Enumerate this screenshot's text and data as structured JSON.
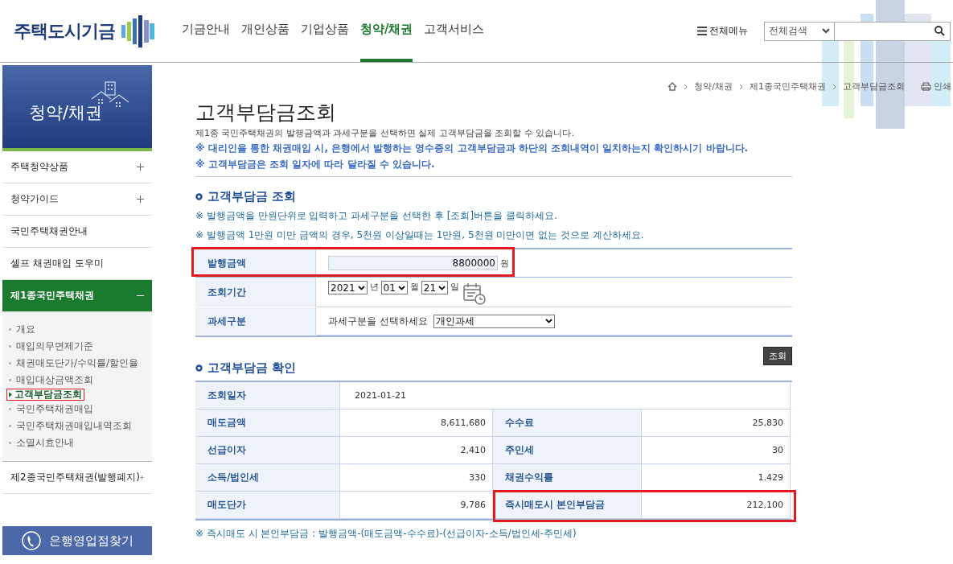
{
  "header": {
    "logo": "주택도시기금",
    "nav": [
      {
        "label": "기금안내",
        "selected": false
      },
      {
        "label": "개인상품",
        "selected": false
      },
      {
        "label": "기업상품",
        "selected": false
      },
      {
        "label": "청약/채권",
        "selected": true
      },
      {
        "label": "고객서비스",
        "selected": false
      }
    ],
    "all_menu": "전체메뉴",
    "search_scope": "전체검색"
  },
  "sidebar": {
    "title": "청약/채권",
    "items": [
      {
        "label": "주택청약상품",
        "expanded": false
      },
      {
        "label": "청약가이드",
        "expanded": false
      },
      {
        "label": "국민주택채권안내"
      },
      {
        "label": "셀프 채권매입 도우미"
      },
      {
        "label": "제1종국민주택채권",
        "expanded": true,
        "children": [
          {
            "label": "개요",
            "selected": false,
            "highlighted": false
          },
          {
            "label": "매입의무면제기준",
            "selected": false,
            "highlighted": false
          },
          {
            "label": "채권매도단가/수익률/할인율",
            "selected": false,
            "highlighted": false
          },
          {
            "label": "매입대상금액조회",
            "selected": false,
            "highlighted": false
          },
          {
            "label": "고객부담금조회",
            "selected": true,
            "highlighted": true
          },
          {
            "label": "국민주택채권매입",
            "selected": false,
            "highlighted": false
          },
          {
            "label": "국민주택채권매입내역조회",
            "selected": false,
            "highlighted": false
          },
          {
            "label": "소멸시효안내",
            "selected": false,
            "highlighted": false
          }
        ]
      },
      {
        "label": "제2종국민주택채권(발행폐지)",
        "expanded": false
      }
    ],
    "bank_button": "은행영업점찾기"
  },
  "breadcrumb": [
    "청약/채권",
    "제1종국민주택채권",
    "고객부담금조회"
  ],
  "print": "인쇄",
  "title": "고객부담금조회",
  "description": "제1종 국민주택채권의 발행금액과 과세구분을 선택하면 실제 고객부담금을 조회할 수 있습니다.",
  "notices": [
    "※ 대리인을 통한 채권매입 시, 은행에서 발행하는 영수증의 고객부담금과 하단의 조회내역이 일치하는지 확인하시기 바랍니다.",
    "※ 고객부담금은 조회 일자에 따라 달라질 수 있습니다."
  ],
  "query": {
    "heading": "고객부담금 조회",
    "notes": [
      "※ 발행금액을 만원단위로 입력하고 과세구분을 선택한 후 [조회]버튼을 클릭하세요.",
      "※ 발행금액 1만원 미만 금액의 경우, 5천원 이상일때는 1만원, 5천원 미만이면 없는 것으로 계산하세요."
    ],
    "amount": {
      "label": "발행금액",
      "value": "8800000",
      "unit": "원",
      "highlighted": true
    },
    "period": {
      "label": "조회기간",
      "year": "2021",
      "year_unit": "년",
      "month": "01",
      "month_unit": "월",
      "day": "21",
      "day_unit": "일"
    },
    "tax": {
      "label": "과세구분",
      "prompt": "과세구분을 선택하세요",
      "value": "개인과세"
    },
    "button": "조회"
  },
  "result": {
    "heading": "고객부담금 확인",
    "rows": [
      [
        {
          "label": "조회일자",
          "value": "2021-01-21",
          "highlighted": false
        }
      ],
      [
        {
          "label": "매도금액",
          "value": "8,611,680",
          "highlighted": false
        },
        {
          "label": "수수료",
          "value": "25,830",
          "highlighted": false
        }
      ],
      [
        {
          "label": "선급이자",
          "value": "2,410",
          "highlighted": false
        },
        {
          "label": "주민세",
          "value": "30",
          "highlighted": false
        }
      ],
      [
        {
          "label": "소득/법인세",
          "value": "330",
          "highlighted": false
        },
        {
          "label": "채권수익률",
          "value": "1.429",
          "highlighted": false
        }
      ],
      [
        {
          "label": "매도단가",
          "value": "9,786",
          "highlighted": false
        },
        {
          "label": "즉시매도시 본인부담금",
          "value": "212,100",
          "highlighted": true
        }
      ]
    ],
    "formula": "※ 즉시매도 시 본인부담금 : 발행금액-(매도금액-수수료)-(선급이자-소득/법인세-주민세)"
  }
}
